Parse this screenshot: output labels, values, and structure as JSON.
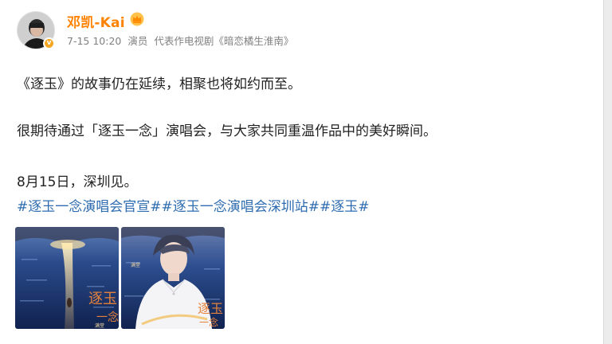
{
  "post": {
    "author": "邓凯-Kai",
    "timestamp": "7-15 10:20",
    "role": "演员",
    "representative_works": "代表作电视剧《暗恋橘生淮南》",
    "lines": [
      "《逐玉》的故事仍在延续，相聚也将如约而至。",
      "很期待通过「逐玉一念」演唱会，与大家共同重温作品中的美好瞬间。",
      "8月15日，深圳见。"
    ],
    "hashtags": [
      "#逐玉一念演唱会官宣#",
      "#逐玉一念演唱会深圳站#",
      "#逐玉#"
    ],
    "images": [
      {
        "name": "poster-1",
        "overlay_title": "逐玉",
        "overlay_sub": "一念",
        "caption": "满堂"
      },
      {
        "name": "poster-2",
        "overlay_title": "逐玉",
        "overlay_sub": "一念",
        "caption": "满堂"
      }
    ]
  },
  "colors": {
    "username": "#ff8200",
    "hashtag": "#2f6db0",
    "meta": "#808080",
    "body_text": "#222222"
  },
  "icons": [
    "crown-icon",
    "verified-badge-icon"
  ]
}
